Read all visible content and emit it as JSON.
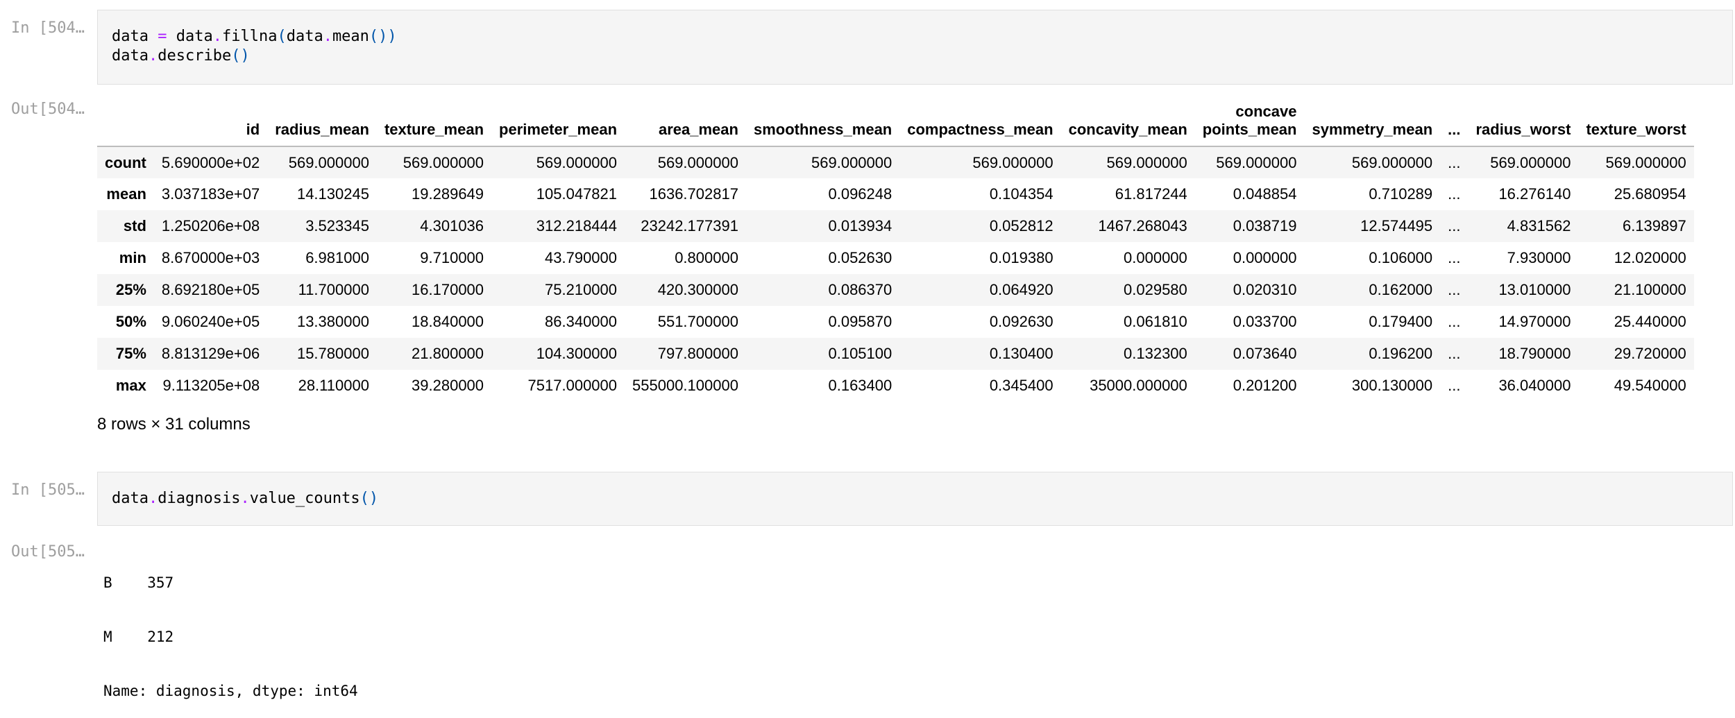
{
  "cell504": {
    "in_prompt": "In [504…",
    "out_prompt": "Out[504…",
    "code": {
      "line1": {
        "a": "data ",
        "op1": "=",
        "b": " data",
        "dot1": ".",
        "c": "fillna",
        "p1": "(",
        "d": "data",
        "dot2": ".",
        "e": "mean",
        "p2": "())"
      },
      "line2": {
        "a": "data",
        "dot": ".",
        "b": "describe",
        "p": "()"
      }
    },
    "table": {
      "columns": [
        "",
        "id",
        "radius_mean",
        "texture_mean",
        "perimeter_mean",
        "area_mean",
        "smoothness_mean",
        "compactness_mean",
        "concavity_mean",
        "concave points_mean",
        "symmetry_mean",
        "...",
        "radius_worst",
        "texture_worst"
      ],
      "rows": [
        [
          "count",
          "5.690000e+02",
          "569.000000",
          "569.000000",
          "569.000000",
          "569.000000",
          "569.000000",
          "569.000000",
          "569.000000",
          "569.000000",
          "569.000000",
          "...",
          "569.000000",
          "569.000000"
        ],
        [
          "mean",
          "3.037183e+07",
          "14.130245",
          "19.289649",
          "105.047821",
          "1636.702817",
          "0.096248",
          "0.104354",
          "61.817244",
          "0.048854",
          "0.710289",
          "...",
          "16.276140",
          "25.680954"
        ],
        [
          "std",
          "1.250206e+08",
          "3.523345",
          "4.301036",
          "312.218444",
          "23242.177391",
          "0.013934",
          "0.052812",
          "1467.268043",
          "0.038719",
          "12.574495",
          "...",
          "4.831562",
          "6.139897"
        ],
        [
          "min",
          "8.670000e+03",
          "6.981000",
          "9.710000",
          "43.790000",
          "0.800000",
          "0.052630",
          "0.019380",
          "0.000000",
          "0.000000",
          "0.106000",
          "...",
          "7.930000",
          "12.020000"
        ],
        [
          "25%",
          "8.692180e+05",
          "11.700000",
          "16.170000",
          "75.210000",
          "420.300000",
          "0.086370",
          "0.064920",
          "0.029580",
          "0.020310",
          "0.162000",
          "...",
          "13.010000",
          "21.100000"
        ],
        [
          "50%",
          "9.060240e+05",
          "13.380000",
          "18.840000",
          "86.340000",
          "551.700000",
          "0.095870",
          "0.092630",
          "0.061810",
          "0.033700",
          "0.179400",
          "...",
          "14.970000",
          "25.440000"
        ],
        [
          "75%",
          "8.813129e+06",
          "15.780000",
          "21.800000",
          "104.300000",
          "797.800000",
          "0.105100",
          "0.130400",
          "0.132300",
          "0.073640",
          "0.196200",
          "...",
          "18.790000",
          "29.720000"
        ],
        [
          "max",
          "9.113205e+08",
          "28.110000",
          "39.280000",
          "7517.000000",
          "555000.100000",
          "0.163400",
          "0.345400",
          "35000.000000",
          "0.201200",
          "300.130000",
          "...",
          "36.040000",
          "49.540000"
        ]
      ]
    },
    "shape_text": "8 rows × 31 columns"
  },
  "cell505": {
    "in_prompt": "In [505…",
    "out_prompt": "Out[505…",
    "code": {
      "a": "data",
      "dot1": ".",
      "b": "diagnosis",
      "dot2": ".",
      "c": "value_counts",
      "p": "()"
    },
    "output_lines": [
      "B    357",
      "M    212",
      "Name: diagnosis, dtype: int64"
    ]
  }
}
